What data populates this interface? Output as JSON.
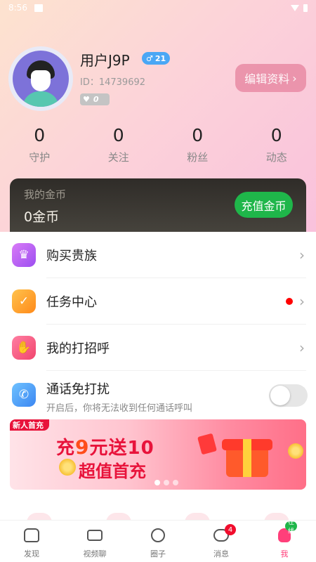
{
  "status_bar": {
    "time": "8:56"
  },
  "profile": {
    "username": "用户J9P",
    "gender_symbol": "♂",
    "age": "21",
    "user_id": "ID：14739692",
    "level": "0",
    "edit_label": "编辑资料",
    "edit_chevron": "›"
  },
  "stats": [
    {
      "value": "0",
      "label": "守护"
    },
    {
      "value": "0",
      "label": "关注"
    },
    {
      "value": "0",
      "label": "粉丝"
    },
    {
      "value": "0",
      "label": "动态"
    }
  ],
  "coins": {
    "title": "我的金币",
    "amount": "0金币",
    "recharge_label": "充值金币"
  },
  "menu": [
    {
      "label": "购买贵族",
      "icon": "crown-icon",
      "chevron": "›"
    },
    {
      "label": "任务中心",
      "icon": "task-icon",
      "chevron": "›"
    },
    {
      "label": "我的打招呼",
      "icon": "wave-hand-icon",
      "chevron": "›"
    }
  ],
  "dnd": {
    "title": "通话免打扰",
    "subtitle": "开启后，你将无法收到任何通话呼叫",
    "enabled": false
  },
  "banner": {
    "tag": "新人首充",
    "line1_a": "充",
    "line1_b": "9",
    "line1_c": "元送10",
    "line2": "超值首充"
  },
  "tabbar": [
    {
      "label": "发现",
      "icon": "home-icon"
    },
    {
      "label": "视频聊",
      "icon": "video-icon"
    },
    {
      "label": "圈子",
      "icon": "planet-icon"
    },
    {
      "label": "消息",
      "icon": "message-icon",
      "badge": "4"
    },
    {
      "label": "我",
      "icon": "me-icon",
      "badge": "在线",
      "active": true
    }
  ],
  "colors": {
    "accent": "#ff3f7a",
    "recharge_green": "#1fb64a",
    "edit_pink": "#e98ba5"
  }
}
